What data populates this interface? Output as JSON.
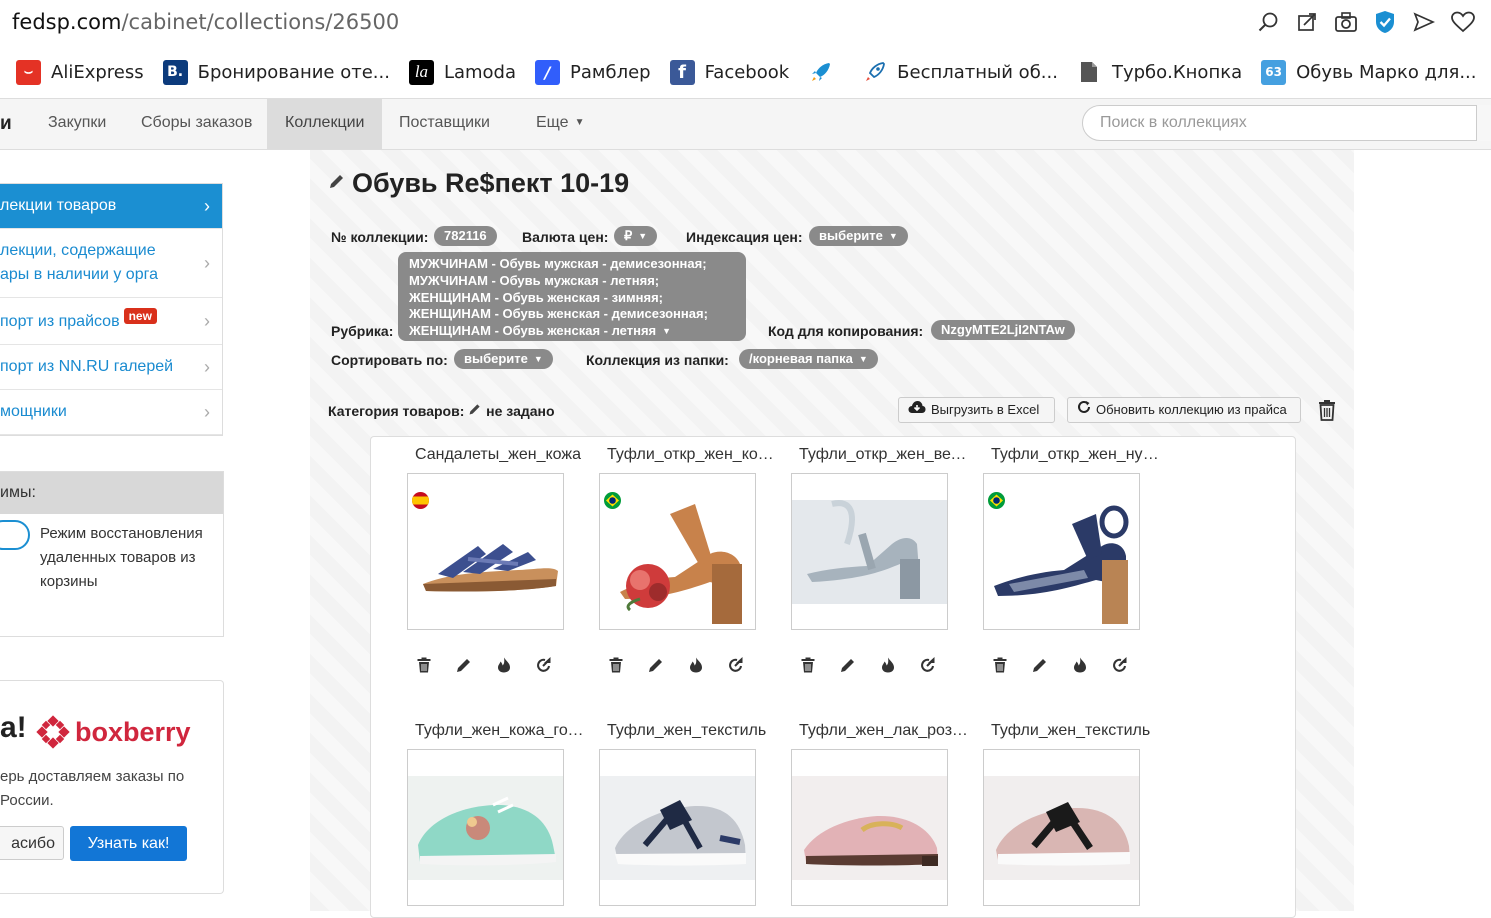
{
  "browser": {
    "url_host": "fedsp.com",
    "url_path": "/cabinet/collections/26500",
    "bookmarks": [
      {
        "label": "AliExpress",
        "icon": "aliexpress-icon",
        "color": "#e43225"
      },
      {
        "label": "Бронирование оте...",
        "icon": "booking-icon",
        "color": "#0c3b7c"
      },
      {
        "label": "Lamoda",
        "icon": "lamoda-icon",
        "color": "#000000"
      },
      {
        "label": "Рамблер",
        "icon": "rambler-icon",
        "color": "#315efb"
      },
      {
        "label": "Facebook",
        "icon": "facebook-icon",
        "color": "#3b5998"
      },
      {
        "label": "",
        "icon": "rocket-icon",
        "color": "#1b8fd2"
      },
      {
        "label": "Бесплатный об...",
        "icon": "rocket2-icon",
        "color": "#1b8fd2"
      },
      {
        "label": "Турбо.Кнопка",
        "icon": "document-icon",
        "color": "#555555"
      },
      {
        "label": "Обувь Марко для...",
        "icon": "site-icon",
        "color": "#45a0e0"
      }
    ]
  },
  "nav": {
    "edge_label": "и",
    "items": [
      "Закупки",
      "Сборы заказов",
      "Коллекции",
      "Поставщики",
      "Еще"
    ],
    "active_index": 2,
    "search_placeholder": "Поиск в коллекциях"
  },
  "sidebar": {
    "items": [
      {
        "label": "лекции товаров",
        "active": true
      },
      {
        "label": "лекции, содержащие\nары в наличии у орга",
        "active": false
      },
      {
        "label": "порт из прайсов",
        "badge": "new",
        "active": false
      },
      {
        "label": "порт из NN.RU галерей",
        "active": false
      },
      {
        "label": "мощники",
        "active": false
      }
    ],
    "modes_header": "имы:",
    "mode_text": "Режим восстановления удаленных товаров из корзины",
    "promo": {
      "title": "а!",
      "brand": "boxberry",
      "text": "ерь доставляем заказы по\n России.",
      "thanks_label": "асибо",
      "learn_label": "Узнать как!"
    }
  },
  "collection": {
    "title": "Обувь Re$пект 10-19",
    "number_label": "№ коллекции:",
    "number_value": "782116",
    "currency_label": "Валюта цен:",
    "currency_value": "₽",
    "indexation_label": "Индексация цен:",
    "indexation_value": "выберите",
    "rubric_label": "Рубрика:",
    "rubric_lines": [
      "МУЖЧИНАМ - Обувь мужская - демисезонная;",
      "МУЖЧИНАМ - Обувь мужская - летняя;",
      "ЖЕНЩИНАМ - Обувь женская - зимняя;",
      "ЖЕНЩИНАМ - Обувь женская - демисезонная;",
      "ЖЕНЩИНАМ - Обувь женская - летняя"
    ],
    "copy_code_label": "Код для копирования:",
    "copy_code_value": "NzgyMTE2LjI2NTAw",
    "sort_label": "Сортировать по:",
    "sort_value": "выберите",
    "folder_label": "Коллекция из папки:",
    "folder_value": "/корневая папка",
    "category_label": "Категория товаров:",
    "category_value": "не задано",
    "export_label": "Выгрузить в Excel",
    "refresh_label": "Обновить коллекцию из прайса"
  },
  "products": [
    {
      "name": "Сандалеты_жен_кожа",
      "flag": "spain",
      "shoe": "sandal-blue"
    },
    {
      "name": "Туфли_откр_жен_кожа",
      "flag": "brazil",
      "shoe": "heel-tan"
    },
    {
      "name": "Туфли_откр_жен_велюр",
      "flag": "",
      "shoe": "heel-grey"
    },
    {
      "name": "Туфли_откр_жен_нубук",
      "flag": "brazil",
      "shoe": "heel-navy"
    },
    {
      "name": "Туфли_жен_кожа_голубой",
      "flag": "",
      "shoe": "sneaker-mint"
    },
    {
      "name": "Туфли_жен_текстиль",
      "flag": "",
      "shoe": "sneaker-grey"
    },
    {
      "name": "Туфли_жен_лак_розовый",
      "flag": "",
      "shoe": "loafer-pink"
    },
    {
      "name": "Туфли_жен_текстиль",
      "flag": "",
      "shoe": "sneaker-pink"
    }
  ],
  "colors": {
    "accent": "#1b8fd2",
    "pill": "#8a8a8a",
    "boxberry": "#d0263d",
    "learn_button": "#1276d6"
  }
}
